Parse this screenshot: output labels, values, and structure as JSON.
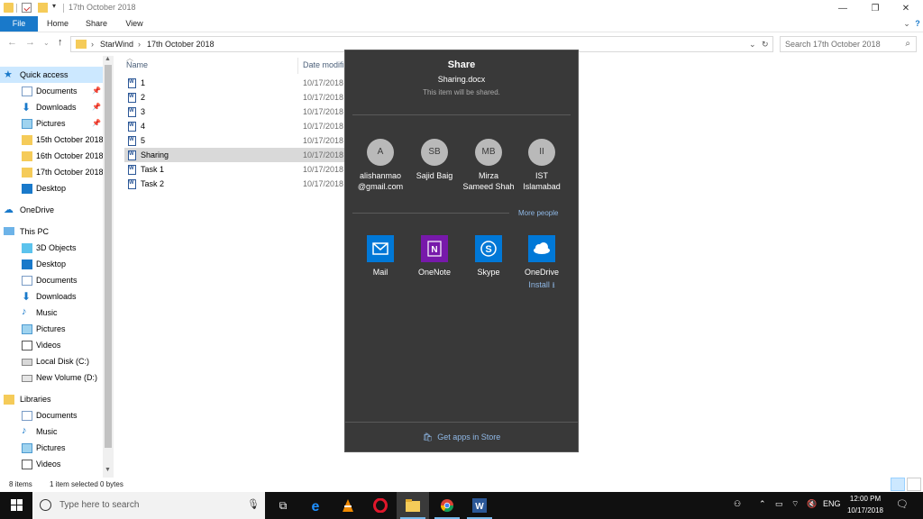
{
  "window": {
    "title": "17th October 2018"
  },
  "ribbon": {
    "tabs": [
      "File",
      "Home",
      "Share",
      "View"
    ]
  },
  "address": {
    "breadcrumbs": [
      "StarWind",
      "17th October 2018"
    ],
    "search_placeholder": "Search 17th October 2018"
  },
  "nav": {
    "quick_access": "Quick access",
    "quick_items": [
      "Documents",
      "Downloads",
      "Pictures",
      "15th October 2018",
      "16th October 2018",
      "17th October 2018",
      "Desktop"
    ],
    "onedrive": "OneDrive",
    "this_pc": "This PC",
    "pc_items": [
      "3D Objects",
      "Desktop",
      "Documents",
      "Downloads",
      "Music",
      "Pictures",
      "Videos",
      "Local Disk (C:)",
      "New Volume (D:)"
    ],
    "libraries": "Libraries",
    "lib_items": [
      "Documents",
      "Music",
      "Pictures",
      "Videos"
    ]
  },
  "filelist": {
    "columns": [
      "Name",
      "Date modifi"
    ],
    "files": [
      {
        "name": "1",
        "date": "10/17/2018"
      },
      {
        "name": "2",
        "date": "10/17/2018"
      },
      {
        "name": "3",
        "date": "10/17/2018"
      },
      {
        "name": "4",
        "date": "10/17/2018"
      },
      {
        "name": "5",
        "date": "10/17/2018"
      },
      {
        "name": "Sharing",
        "date": "10/17/2018"
      },
      {
        "name": "Task 1",
        "date": "10/17/2018"
      },
      {
        "name": "Task 2",
        "date": "10/17/2018"
      }
    ]
  },
  "share": {
    "title": "Share",
    "filename": "Sharing.docx",
    "note": "This item will be shared.",
    "people": [
      {
        "initials": "A",
        "line1": "alishanmao",
        "line2": "@gmail.com"
      },
      {
        "initials": "SB",
        "line1": "Sajid Baig",
        "line2": ""
      },
      {
        "initials": "MB",
        "line1": "Mirza",
        "line2": "Sameed Shah"
      },
      {
        "initials": "II",
        "line1": "IST",
        "line2": "Islamabad"
      }
    ],
    "more_people": "More people",
    "apps": [
      {
        "label": "Mail",
        "color": "#0078d7"
      },
      {
        "label": "OneNote",
        "color": "#7719aa"
      },
      {
        "label": "Skype",
        "color": "#0078d7"
      },
      {
        "label": "OneDrive",
        "color": "#0078d7"
      }
    ],
    "install": "Install",
    "store_link": "Get apps in Store"
  },
  "status": {
    "items": "8 items",
    "selected": "1 item selected  0 bytes"
  },
  "taskbar": {
    "search_placeholder": "Type here to search",
    "lang": "ENG",
    "time": "12:00 PM",
    "date": "10/17/2018"
  }
}
